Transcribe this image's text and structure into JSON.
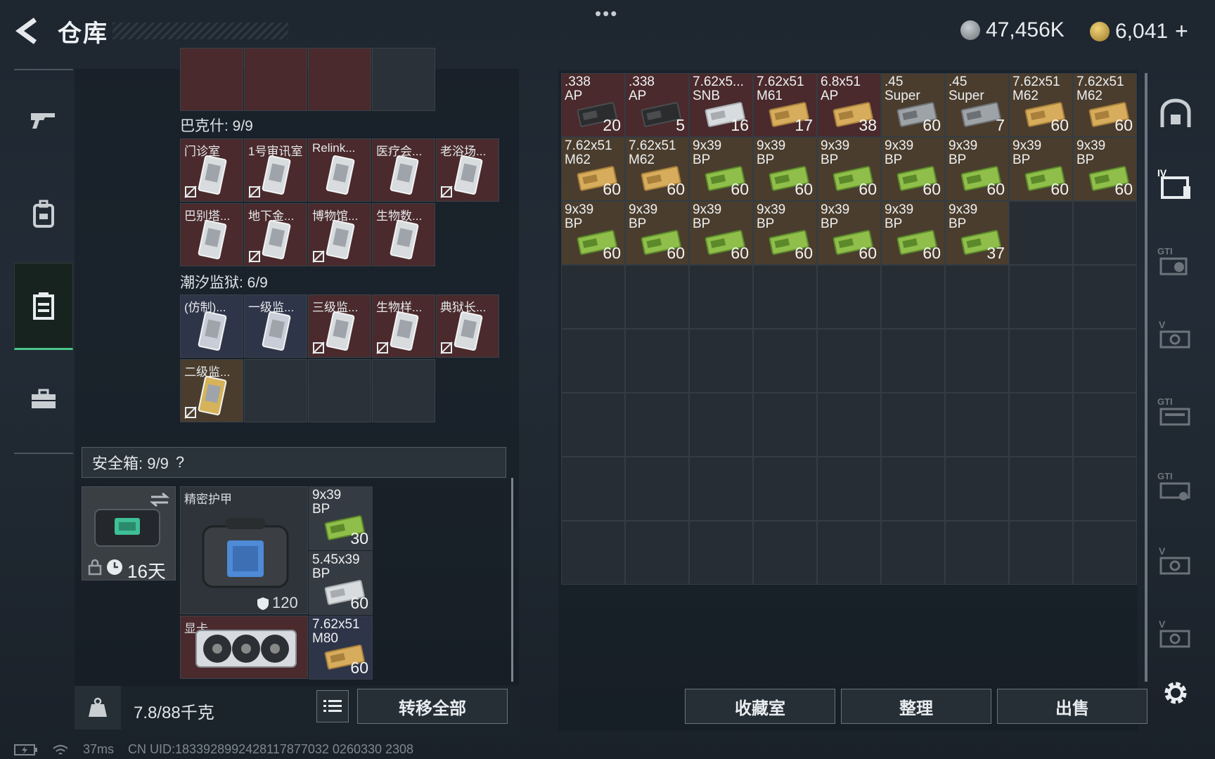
{
  "header": {
    "title": "仓库",
    "menu_dots": "•••",
    "currency_silver": "47,456K",
    "currency_gold": "6,041",
    "add_symbol": "+"
  },
  "sidebar": {
    "items": [
      {
        "name": "weapon-icon"
      },
      {
        "name": "backpack-icon"
      },
      {
        "name": "inventory-icon",
        "active": true
      },
      {
        "name": "toolbox-icon"
      }
    ]
  },
  "key_groups": [
    {
      "label": "巴克什: 9/9",
      "items": [
        {
          "label": "门诊室",
          "color": "red",
          "nodrop": true
        },
        {
          "label": "1号审讯室",
          "color": "red",
          "nodrop": true
        },
        {
          "label": "Relink...",
          "color": "red",
          "nodrop": false
        },
        {
          "label": "医疗会...",
          "color": "red",
          "nodrop": false
        },
        {
          "label": "老浴场...",
          "color": "red",
          "nodrop": true
        },
        {
          "label": "巴别塔...",
          "color": "red",
          "nodrop": false
        },
        {
          "label": "地下金...",
          "color": "red",
          "nodrop": true
        },
        {
          "label": "博物馆...",
          "color": "red",
          "nodrop": true
        },
        {
          "label": "生物数...",
          "color": "red",
          "nodrop": false
        }
      ]
    },
    {
      "label": "潮汐监狱: 6/9",
      "items": [
        {
          "label": "(仿制)...",
          "color": "blue",
          "nodrop": false
        },
        {
          "label": "一级监...",
          "color": "blue",
          "nodrop": false
        },
        {
          "label": "三级监...",
          "color": "red",
          "nodrop": true
        },
        {
          "label": "生物样...",
          "color": "red",
          "nodrop": true
        },
        {
          "label": "典狱长...",
          "color": "red",
          "nodrop": true
        },
        {
          "label": "二级监...",
          "color": "gold",
          "nodrop": true
        }
      ]
    }
  ],
  "safebox": {
    "label": "安全箱: 9/9",
    "help": "?",
    "days": "16天",
    "armor_label": "精密护甲",
    "armor_value": "120",
    "gpu_label": "显卡",
    "ammo": [
      {
        "label": "9x39\nBP",
        "count": "30"
      },
      {
        "label": "5.45x39\nBP",
        "count": "60"
      },
      {
        "label": "7.62x51\nM80",
        "count": "60"
      }
    ]
  },
  "footer_left": {
    "weight": "7.8/88千克",
    "transfer_all": "转移全部"
  },
  "stash_items": [
    {
      "label": ".338\nAP",
      "count": "20",
      "color": "red",
      "kind": "black"
    },
    {
      "label": ".338\nAP",
      "count": "5",
      "color": "red",
      "kind": "black"
    },
    {
      "label": "7.62x5...\nSNB",
      "count": "16",
      "color": "red",
      "kind": "white"
    },
    {
      "label": "7.62x51\nM61",
      "count": "17",
      "color": "red",
      "kind": "tan"
    },
    {
      "label": "6.8x51\nAP",
      "count": "38",
      "color": "red",
      "kind": "tan"
    },
    {
      "label": ".45\nSuper",
      "count": "60",
      "color": "gold",
      "kind": "grey"
    },
    {
      "label": ".45\nSuper",
      "count": "7",
      "color": "gold",
      "kind": "grey"
    },
    {
      "label": "7.62x51\nM62",
      "count": "60",
      "color": "gold",
      "kind": "tan"
    },
    {
      "label": "7.62x51\nM62",
      "count": "60",
      "color": "gold",
      "kind": "tan"
    },
    {
      "label": "7.62x51\nM62",
      "count": "60",
      "color": "gold",
      "kind": "tan"
    },
    {
      "label": "7.62x51\nM62",
      "count": "60",
      "color": "gold",
      "kind": "tan"
    },
    {
      "label": "9x39\nBP",
      "count": "60",
      "color": "gold",
      "kind": "green"
    },
    {
      "label": "9x39\nBP",
      "count": "60",
      "color": "gold",
      "kind": "green"
    },
    {
      "label": "9x39\nBP",
      "count": "60",
      "color": "gold",
      "kind": "green"
    },
    {
      "label": "9x39\nBP",
      "count": "60",
      "color": "gold",
      "kind": "green"
    },
    {
      "label": "9x39\nBP",
      "count": "60",
      "color": "gold",
      "kind": "green"
    },
    {
      "label": "9x39\nBP",
      "count": "60",
      "color": "gold",
      "kind": "green"
    },
    {
      "label": "9x39\nBP",
      "count": "60",
      "color": "gold",
      "kind": "green"
    },
    {
      "label": "9x39\nBP",
      "count": "60",
      "color": "gold",
      "kind": "green"
    },
    {
      "label": "9x39\nBP",
      "count": "60",
      "color": "gold",
      "kind": "green"
    },
    {
      "label": "9x39\nBP",
      "count": "60",
      "color": "gold",
      "kind": "green"
    },
    {
      "label": "9x39\nBP",
      "count": "60",
      "color": "gold",
      "kind": "green"
    },
    {
      "label": "9x39\nBP",
      "count": "60",
      "color": "gold",
      "kind": "green"
    },
    {
      "label": "9x39\nBP",
      "count": "60",
      "color": "gold",
      "kind": "green"
    },
    {
      "label": "9x39\nBP",
      "count": "37",
      "color": "gold",
      "kind": "green"
    }
  ],
  "footer_right": {
    "collection": "收藏室",
    "sort": "整理",
    "sell": "出售"
  },
  "right_rail": {
    "items": [
      "home-icon",
      "folder-icon",
      "gti-ammo-icon",
      "v-case-icon",
      "gti-case-icon",
      "gti-tools-icon",
      "v-case-icon",
      "v-case-icon"
    ],
    "tier_label": "IV",
    "gti_label": "GTI",
    "v_label": "V"
  },
  "status": {
    "ping": "37ms",
    "uid": "CN UID:1833928992428117877032 0260330 2308"
  },
  "colors": {
    "red": "#4a2a2c",
    "gold": "#4a3d2d",
    "blue": "#2e3548",
    "accent_green": "#4ac68a"
  }
}
